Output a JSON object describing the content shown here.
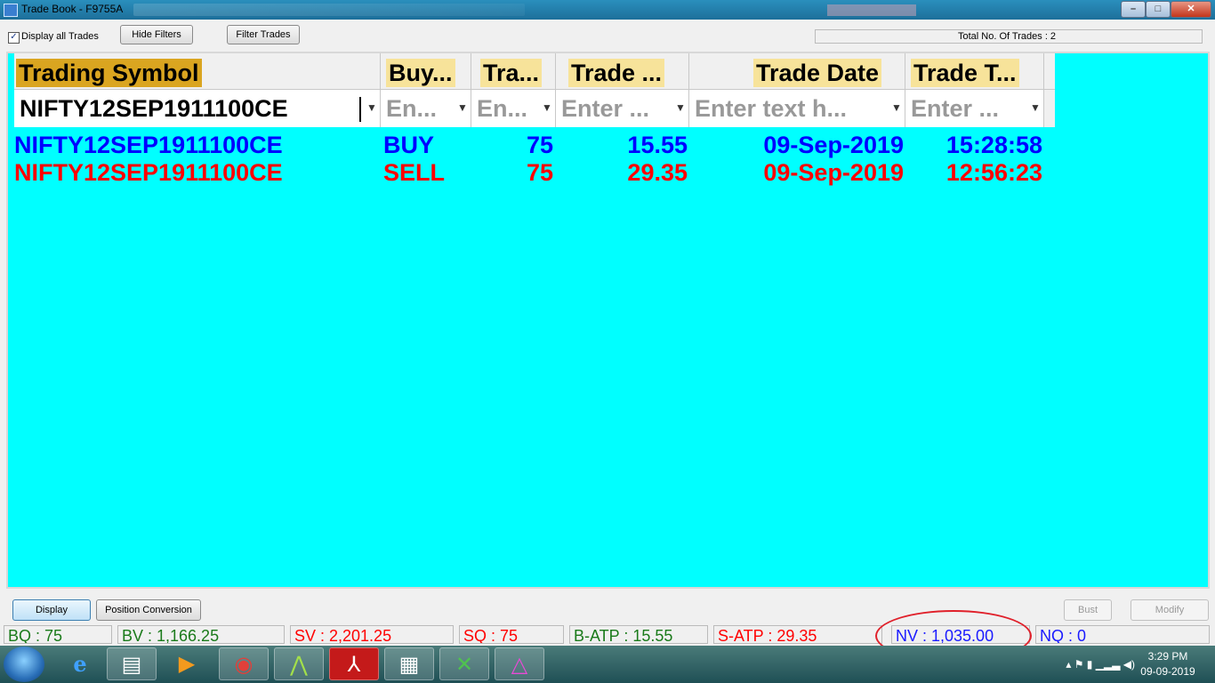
{
  "window": {
    "title": "Trade Book - F9755A"
  },
  "toolbar": {
    "display_all_label": "Display all Trades",
    "display_all_checked": true,
    "hide_filters_label": "Hide Filters",
    "filter_trades_label": "Filter Trades",
    "total_trades": "Total No. Of Trades : 2"
  },
  "grid": {
    "columns": [
      {
        "header": "Trading Symbol",
        "filter": "NIFTY12SEP1911100CE",
        "filter_is_value": true
      },
      {
        "header": "Buy...",
        "filter": "En..."
      },
      {
        "header": "Tra...",
        "filter": "En..."
      },
      {
        "header": "Trade ...",
        "filter": "Enter ..."
      },
      {
        "header": "Trade Date",
        "filter": "Enter text h..."
      },
      {
        "header": "Trade T...",
        "filter": "Enter ..."
      }
    ],
    "rows": [
      {
        "side": "buy",
        "color": "#0000ff",
        "cells": [
          "NIFTY12SEP1911100CE",
          "BUY",
          "75",
          "15.55",
          "09-Sep-2019",
          "15:28:58"
        ]
      },
      {
        "side": "sell",
        "color": "#ff0000",
        "cells": [
          "NIFTY12SEP1911100CE",
          "SELL",
          "75",
          "29.35",
          "09-Sep-2019",
          "12:56:23"
        ]
      }
    ],
    "background": "#00ffff"
  },
  "actions": {
    "display_label": "Display",
    "position_conversion_label": "Position Conversion",
    "bust_label": "Bust",
    "modify_label": "Modify"
  },
  "status": {
    "bq": "BQ : 75",
    "bv": "BV : 1,166.25",
    "sv": "SV : 2,201.25",
    "sq": "SQ : 75",
    "batp": "B-ATP : 15.55",
    "satp": "S-ATP : 29.35",
    "nv": "NV : 1,035.00",
    "nq": "NQ : 0"
  },
  "taskbar": {
    "icons": [
      "windows-start-icon",
      "internet-explorer-icon",
      "file-explorer-icon",
      "media-player-icon",
      "chrome-icon",
      "trading-terminal-icon",
      "pdf-reader-icon",
      "calculator-icon",
      "excel-icon",
      "trading-app-icon"
    ],
    "clock_time": "3:29 PM",
    "clock_date": "09-09-2019"
  }
}
